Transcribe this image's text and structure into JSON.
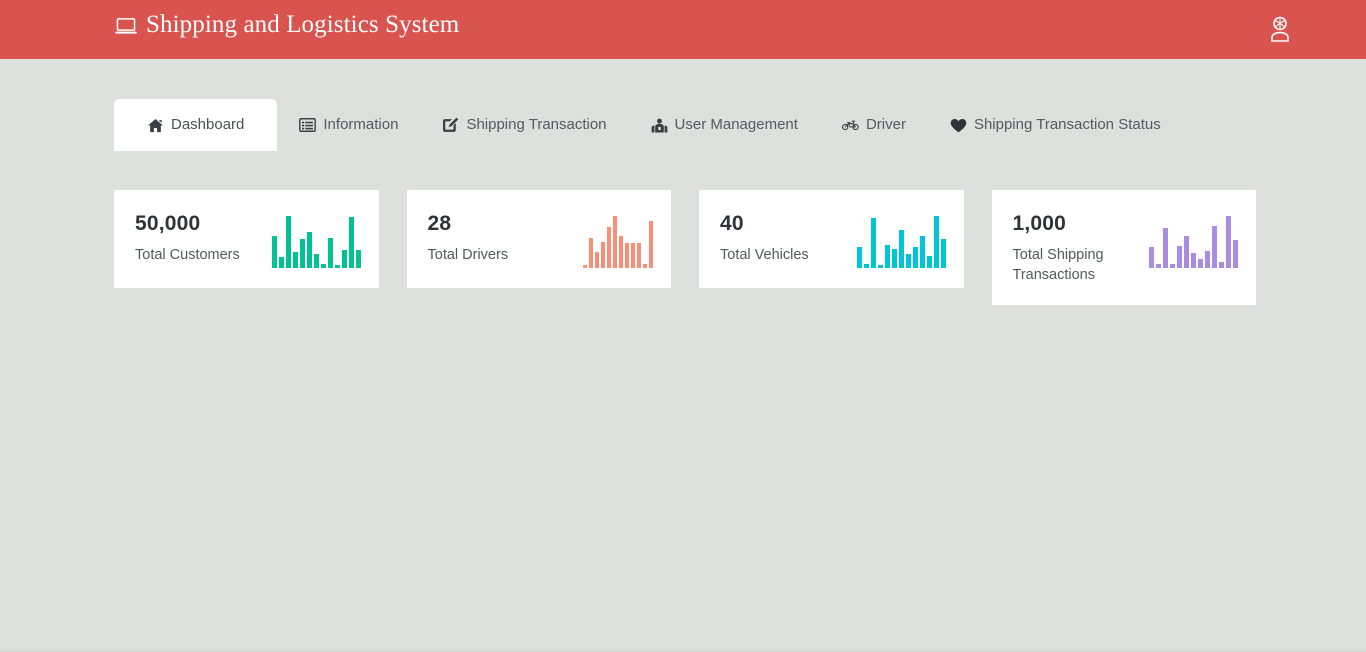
{
  "header": {
    "title": "Shipping and Logistics System",
    "brand_icon": "laptop-icon",
    "user_icon": "user-account-icon",
    "background_color": "#d9534f",
    "text_color": "#ffffff"
  },
  "page": {
    "background_color": "#dce1de"
  },
  "tabs": [
    {
      "label": "Dashboard",
      "icon": "home-icon",
      "active": true
    },
    {
      "label": "Information",
      "icon": "list-alt-icon",
      "active": false
    },
    {
      "label": "Shipping Transaction",
      "icon": "pencil-square-icon",
      "active": false
    },
    {
      "label": "User Management",
      "icon": "users-icon",
      "active": false
    },
    {
      "label": "Driver",
      "icon": "motorcycle-icon",
      "active": false
    },
    {
      "label": "Shipping Transaction Status",
      "icon": "heart-icon",
      "active": false
    }
  ],
  "cards": [
    {
      "value": "50,000",
      "label": "Total Customers",
      "accent_color": "#00c292",
      "spark_values": [
        62,
        22,
        100,
        30,
        55,
        70,
        26,
        8,
        58,
        5,
        35,
        98,
        34
      ]
    },
    {
      "value": "28",
      "label": "Total Drivers",
      "accent_color": "#f98e76",
      "spark_values": [
        6,
        58,
        30,
        50,
        78,
        100,
        62,
        48,
        48,
        48,
        8,
        90
      ]
    },
    {
      "value": "40",
      "label": "Total Vehicles",
      "accent_color": "#00c6d4",
      "spark_values": [
        40,
        8,
        96,
        6,
        44,
        36,
        74,
        26,
        40,
        62,
        24,
        100,
        56
      ]
    },
    {
      "value": "1,000",
      "label": "Total Shipping Transactions",
      "accent_color": "#ab8ce4",
      "spark_values": [
        40,
        8,
        76,
        8,
        42,
        62,
        28,
        18,
        32,
        80,
        12,
        100,
        54
      ]
    }
  ],
  "chart_data": [
    {
      "type": "bar",
      "title": "Total Customers",
      "values": [
        62,
        22,
        100,
        30,
        55,
        70,
        26,
        8,
        58,
        5,
        35,
        98,
        34
      ],
      "ylim": [
        0,
        100
      ],
      "xlabel": "",
      "ylabel": "",
      "grid": false,
      "legend": false,
      "color": "#00c292"
    },
    {
      "type": "bar",
      "title": "Total Drivers",
      "values": [
        6,
        58,
        30,
        50,
        78,
        100,
        62,
        48,
        48,
        48,
        8,
        90
      ],
      "ylim": [
        0,
        100
      ],
      "xlabel": "",
      "ylabel": "",
      "grid": false,
      "legend": false,
      "color": "#f98e76"
    },
    {
      "type": "bar",
      "title": "Total Vehicles",
      "values": [
        40,
        8,
        96,
        6,
        44,
        36,
        74,
        26,
        40,
        62,
        24,
        100,
        56
      ],
      "ylim": [
        0,
        100
      ],
      "xlabel": "",
      "ylabel": "",
      "grid": false,
      "legend": false,
      "color": "#00c6d4"
    },
    {
      "type": "bar",
      "title": "Total Shipping Transactions",
      "values": [
        40,
        8,
        76,
        8,
        42,
        62,
        28,
        18,
        32,
        80,
        12,
        100,
        54
      ],
      "ylim": [
        0,
        100
      ],
      "xlabel": "",
      "ylabel": "",
      "grid": false,
      "legend": false,
      "color": "#ab8ce4"
    }
  ]
}
